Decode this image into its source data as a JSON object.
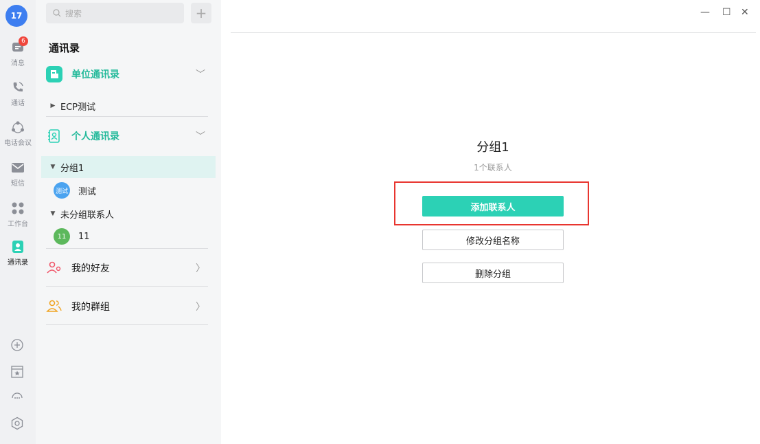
{
  "rail": {
    "avatar_text": "17",
    "items": [
      {
        "label": "消息",
        "badge": "6",
        "icon": "message-icon"
      },
      {
        "label": "通话",
        "icon": "phone-icon"
      },
      {
        "label": "电话会议",
        "icon": "conference-icon"
      },
      {
        "label": "短信",
        "icon": "sms-icon"
      },
      {
        "label": "工作台",
        "icon": "workbench-icon"
      },
      {
        "label": "通讯录",
        "icon": "contacts-icon",
        "active": true
      }
    ],
    "bottom_icons": [
      "add-circle-icon",
      "calendar-star-icon",
      "support-icon",
      "settings-icon"
    ]
  },
  "sidebar": {
    "search_placeholder": "搜索",
    "add_label": "+",
    "title": "通讯录",
    "org_section": {
      "label": "单位通讯录"
    },
    "org_items": [
      {
        "label": "ECP测试"
      }
    ],
    "personal_section": {
      "label": "个人通讯录"
    },
    "groups": [
      {
        "label": "分组1",
        "contacts": [
          {
            "avatar": "测试",
            "name": "测试"
          }
        ]
      },
      {
        "label": "未分组联系人",
        "contacts": [
          {
            "avatar": "11",
            "name": "11"
          }
        ]
      }
    ],
    "friends_label": "我的好友",
    "groups_label": "我的群组"
  },
  "main": {
    "group_title": "分组1",
    "contact_count": "1个联系人",
    "add_contact_label": "添加联系人",
    "rename_group_label": "修改分组名称",
    "delete_group_label": "删除分组"
  },
  "window": {
    "minimize": "—",
    "maximize": "☐",
    "close": "✕"
  },
  "colors": {
    "accent": "#2cd1b5",
    "avatar_blue": "#3d7ef0",
    "badge_red": "#f0463c",
    "highlight_red": "#e8352f",
    "green_contact": "#5cb85c"
  }
}
